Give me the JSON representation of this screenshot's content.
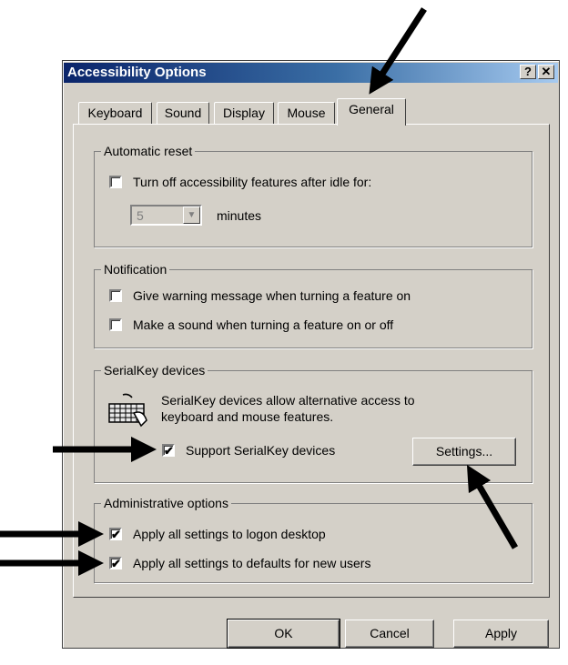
{
  "window": {
    "title": "Accessibility Options",
    "help_label": "?",
    "close_label": "✕"
  },
  "tabs": [
    {
      "label": "Keyboard",
      "active": false
    },
    {
      "label": "Sound",
      "active": false
    },
    {
      "label": "Display",
      "active": false
    },
    {
      "label": "Mouse",
      "active": false
    },
    {
      "label": "General",
      "active": true
    }
  ],
  "automatic_reset": {
    "legend": "Automatic reset",
    "checkbox_label": "Turn off accessibility features after idle for:",
    "checked": false,
    "minutes_value": "5",
    "minutes_label": "minutes"
  },
  "notification": {
    "legend": "Notification",
    "items": [
      {
        "label": "Give warning message when turning a feature on",
        "checked": false
      },
      {
        "label": "Make a sound when turning a feature on or off",
        "checked": false
      }
    ]
  },
  "serialkey": {
    "legend": "SerialKey devices",
    "icon": "keyboard-icon",
    "description_line1": "SerialKey devices allow alternative access to",
    "description_line2": "keyboard and mouse features.",
    "checkbox_label": "Support SerialKey devices",
    "checked": true,
    "settings_label": "Settings..."
  },
  "administrative": {
    "legend": "Administrative options",
    "items": [
      {
        "label": "Apply all settings to logon desktop",
        "checked": true
      },
      {
        "label": "Apply all settings to defaults for new users",
        "checked": true
      }
    ]
  },
  "footer": {
    "ok_label": "OK",
    "cancel_label": "Cancel",
    "apply_label": "Apply"
  },
  "colors": {
    "title_start": "#0a246a",
    "title_end": "#a6caf0",
    "face": "#d4d0c8"
  },
  "checkmark_glyph": "✔"
}
